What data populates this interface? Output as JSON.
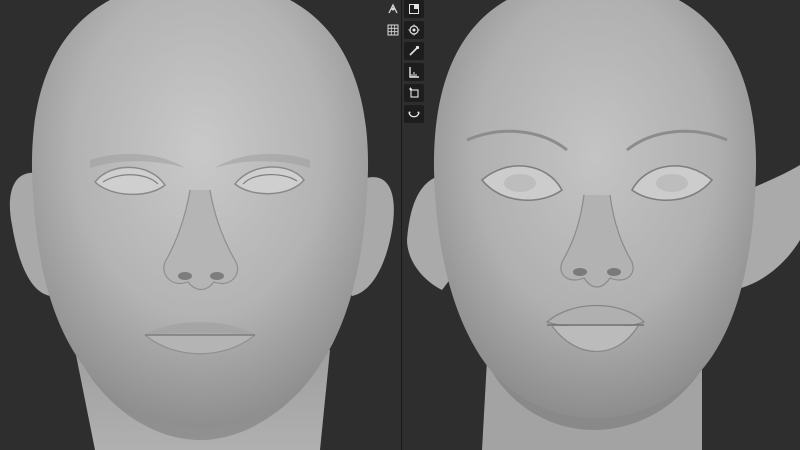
{
  "colors": {
    "background": "#2e2e2e",
    "divider": "#1a1a1a",
    "clay": "#b9b9b9",
    "toolbar_bg": "#1d1d1d",
    "icon": "#e6e6e6"
  },
  "left_viewport": {
    "overlay_icons": [
      "orientation-gizmo-icon",
      "grid-toggle-icon"
    ],
    "subject": "base-head-sculpt"
  },
  "right_viewport": {
    "tool_icons": [
      "transform-cage-icon",
      "target-pivot-icon",
      "sculpt-brush-icon",
      "measure-ruler-icon",
      "add-primitive-icon",
      "smooth-curve-icon"
    ],
    "subject": "detailed-elf-head-sculpt"
  }
}
